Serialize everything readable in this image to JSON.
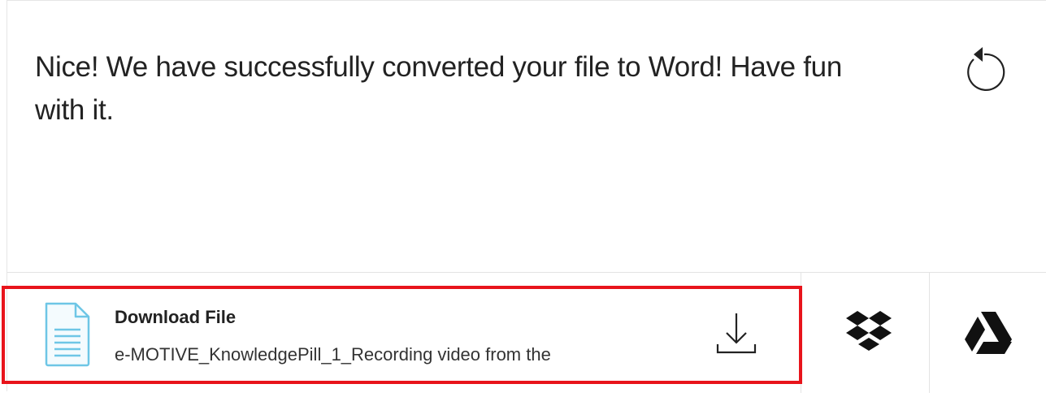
{
  "message": "Nice! We have successfully converted your file to Word! Have fun with it.",
  "download": {
    "title": "Download File",
    "filename": "e-MOTIVE_KnowledgePill_1_Recording video from the"
  },
  "icons": {
    "restart": "restart-icon",
    "file": "document-file-icon",
    "download": "download-icon",
    "dropbox": "dropbox-icon",
    "google_drive": "google-drive-icon"
  },
  "colors": {
    "highlight": "#e8141b",
    "file_icon": "#5bc0de",
    "text": "#222222"
  }
}
